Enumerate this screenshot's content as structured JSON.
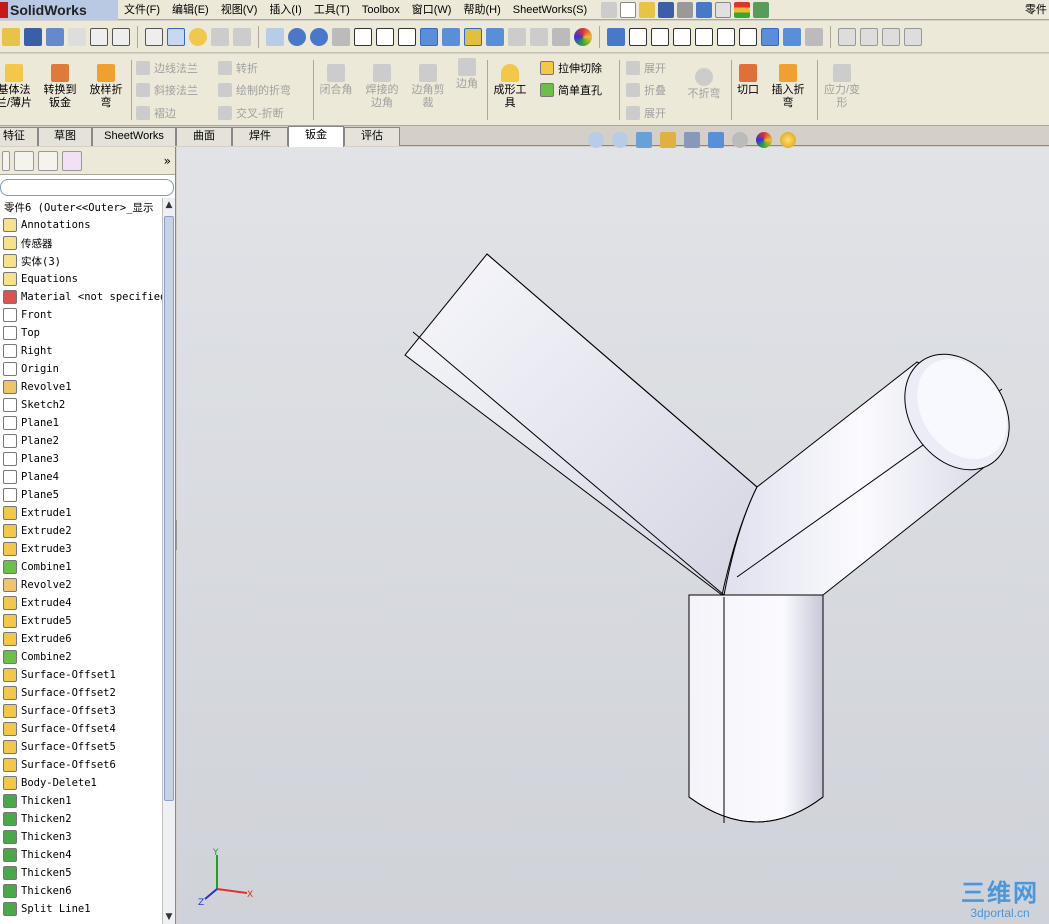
{
  "app": {
    "logo": "SolidWorks",
    "part_name": "零件"
  },
  "menu": [
    "文件(F)",
    "编辑(E)",
    "视图(V)",
    "插入(I)",
    "工具(T)",
    "Toolbox",
    "窗口(W)",
    "帮助(H)",
    "SheetWorks(S)"
  ],
  "cmd": {
    "insert_bends": [
      "基体法",
      "兰/薄片"
    ],
    "convert": [
      "转换到",
      "钣金"
    ],
    "lofted": [
      "放样折",
      "弯"
    ],
    "edge_flange": "边线法兰",
    "miter_flange": "斜接法兰",
    "hem": "褶边",
    "jog": "转折",
    "sketched_bend": "绘制的折弯",
    "cross_break": "交叉-折断",
    "closed_corner": "闭合角",
    "welded_corner": [
      "焊接的",
      "边角"
    ],
    "break_corner": [
      "边角剪",
      "裁"
    ],
    "corner": "边角",
    "forming_tool": [
      "成形工",
      "具"
    ],
    "extruded_cut": "拉伸切除",
    "simple_hole": "简单直孔",
    "unfold": "展开",
    "fold": "折叠",
    "flatten": "展开",
    "no_bends": "不折弯",
    "rip": "切口",
    "insert_bend": [
      "插入折",
      "弯"
    ],
    "stress": [
      "应力/变",
      "形"
    ]
  },
  "tabs": [
    "特征",
    "草图",
    "SheetWorks",
    "曲面",
    "焊件",
    "钣金",
    "评估"
  ],
  "active_tab": "钣金",
  "tree": {
    "root": "零件6  (Outer<<Outer>_显示",
    "items": [
      {
        "label": "Annotations",
        "icon": "annotation-icon",
        "color": "#f5e28a"
      },
      {
        "label": "传感器",
        "icon": "sensor-icon",
        "color": "#f5e28a"
      },
      {
        "label": "实体(3)",
        "icon": "solid-bodies-icon",
        "color": "#f5e28a"
      },
      {
        "label": "Equations",
        "icon": "equations-icon",
        "color": "#f5e28a"
      },
      {
        "label": "Material <not specified",
        "icon": "material-icon",
        "color": "#d9534f"
      },
      {
        "label": "Front",
        "icon": "plane-icon",
        "color": "#ffffff"
      },
      {
        "label": "Top",
        "icon": "plane-icon",
        "color": "#ffffff"
      },
      {
        "label": "Right",
        "icon": "plane-icon",
        "color": "#ffffff"
      },
      {
        "label": "Origin",
        "icon": "origin-icon",
        "color": "#ffffff"
      },
      {
        "label": "Revolve1",
        "icon": "revolve-icon",
        "color": "#f2c46a"
      },
      {
        "label": "Sketch2",
        "icon": "sketch-icon",
        "color": "#ffffff"
      },
      {
        "label": "Plane1",
        "icon": "plane-icon",
        "color": "#ffffff"
      },
      {
        "label": "Plane2",
        "icon": "plane-icon",
        "color": "#ffffff"
      },
      {
        "label": "Plane3",
        "icon": "plane-icon",
        "color": "#ffffff"
      },
      {
        "label": "Plane4",
        "icon": "plane-icon",
        "color": "#ffffff"
      },
      {
        "label": "Plane5",
        "icon": "plane-icon",
        "color": "#ffffff"
      },
      {
        "label": "Extrude1",
        "icon": "extrude-icon",
        "color": "#f3c74a"
      },
      {
        "label": "Extrude2",
        "icon": "extrude-icon",
        "color": "#f3c74a"
      },
      {
        "label": "Extrude3",
        "icon": "extrude-icon",
        "color": "#f3c74a"
      },
      {
        "label": "Combine1",
        "icon": "combine-icon",
        "color": "#6cc04a"
      },
      {
        "label": "Revolve2",
        "icon": "revolve-icon",
        "color": "#f2c46a"
      },
      {
        "label": "Extrude4",
        "icon": "extrude-icon",
        "color": "#f3c74a"
      },
      {
        "label": "Extrude5",
        "icon": "extrude-icon",
        "color": "#f3c74a"
      },
      {
        "label": "Extrude6",
        "icon": "extrude-icon",
        "color": "#f3c74a"
      },
      {
        "label": "Combine2",
        "icon": "combine-icon",
        "color": "#6cc04a"
      },
      {
        "label": "Surface-Offset1",
        "icon": "surface-offset-icon",
        "color": "#f3c74a"
      },
      {
        "label": "Surface-Offset2",
        "icon": "surface-offset-icon",
        "color": "#f3c74a"
      },
      {
        "label": "Surface-Offset3",
        "icon": "surface-offset-icon",
        "color": "#f3c74a"
      },
      {
        "label": "Surface-Offset4",
        "icon": "surface-offset-icon",
        "color": "#f3c74a"
      },
      {
        "label": "Surface-Offset5",
        "icon": "surface-offset-icon",
        "color": "#f3c74a"
      },
      {
        "label": "Surface-Offset6",
        "icon": "surface-offset-icon",
        "color": "#f3c74a"
      },
      {
        "label": "Body-Delete1",
        "icon": "body-delete-icon",
        "color": "#f3c74a"
      },
      {
        "label": "Thicken1",
        "icon": "thicken-icon",
        "color": "#4aa84a"
      },
      {
        "label": "Thicken2",
        "icon": "thicken-icon",
        "color": "#4aa84a"
      },
      {
        "label": "Thicken3",
        "icon": "thicken-icon",
        "color": "#4aa84a"
      },
      {
        "label": "Thicken4",
        "icon": "thicken-icon",
        "color": "#4aa84a"
      },
      {
        "label": "Thicken5",
        "icon": "thicken-icon",
        "color": "#4aa84a"
      },
      {
        "label": "Thicken6",
        "icon": "thicken-icon",
        "color": "#4aa84a"
      },
      {
        "label": "Split Line1",
        "icon": "split-line-icon",
        "color": "#4aa84a"
      }
    ]
  },
  "viewport": {
    "triad": {
      "x": "X",
      "y": "Y",
      "z": "Z"
    }
  },
  "watermark": {
    "big": "三维网",
    "small": "3dportal.cn"
  },
  "colors": {
    "accent": "#316ac5",
    "model_face": "#f4f4fa",
    "model_edge": "#000000"
  }
}
